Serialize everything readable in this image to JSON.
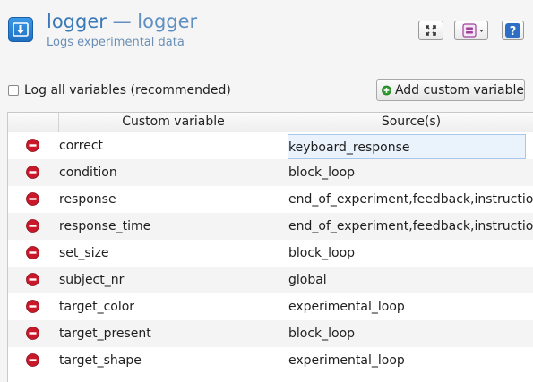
{
  "header": {
    "title": "logger",
    "title_separator": " — ",
    "title_type": "logger",
    "subtitle": "Logs experimental data",
    "icons": {
      "app": "logger-download-icon",
      "fullscreen": "fullscreen-icon",
      "view_toggle": "view-toggle-icon",
      "help": "help-icon"
    },
    "help_glyph": "?"
  },
  "options": {
    "log_all_label": "Log all variables (recommended)",
    "log_all_checked": false,
    "add_button_label": "Add custom variable"
  },
  "table": {
    "columns": [
      "Custom variable",
      "Source(s)"
    ],
    "rows": [
      {
        "variable": "correct",
        "source": "keyboard_response"
      },
      {
        "variable": "condition",
        "source": "block_loop"
      },
      {
        "variable": "response",
        "source": "end_of_experiment,feedback,instructions"
      },
      {
        "variable": "response_time",
        "source": "end_of_experiment,feedback,instructions"
      },
      {
        "variable": "set_size",
        "source": "block_loop"
      },
      {
        "variable": "subject_nr",
        "source": "global"
      },
      {
        "variable": "target_color",
        "source": "experimental_loop"
      },
      {
        "variable": "target_present",
        "source": "block_loop"
      },
      {
        "variable": "target_shape",
        "source": "experimental_loop"
      }
    ]
  },
  "colors": {
    "title": "#3a78b8",
    "delete_icon": "#c9182a",
    "add_icon": "#2f9a2f",
    "help_button": "#2d6fc4"
  }
}
